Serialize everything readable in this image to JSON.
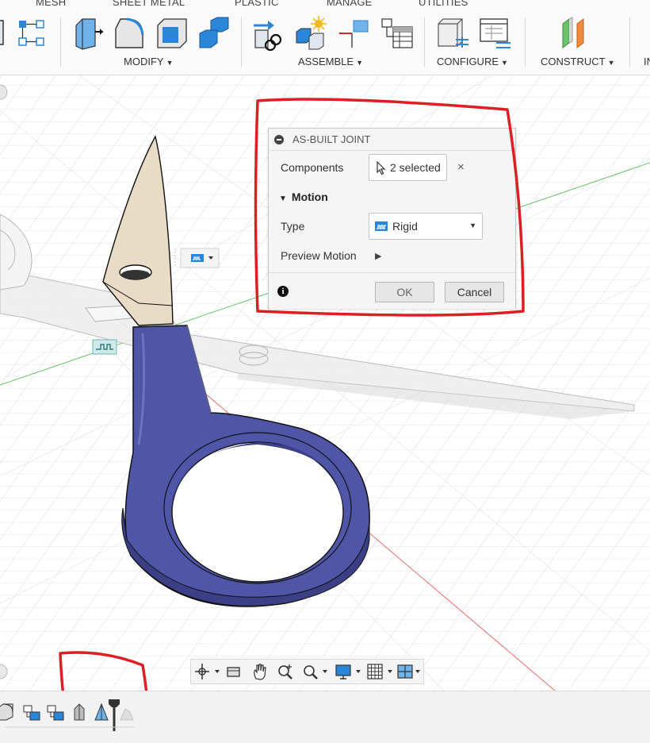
{
  "toolbar": {
    "tabs": [
      "MESH",
      "SHEET METAL",
      "PLASTIC",
      "MANAGE",
      "UTILITIES"
    ],
    "groups": {
      "modify": "MODIFY",
      "assemble": "ASSEMBLE",
      "configure": "CONFIGURE",
      "construct": "CONSTRUCT",
      "inspect_partial": "IN"
    }
  },
  "dialog": {
    "title": "AS-BUILT JOINT",
    "components_label": "Components",
    "components_value": "2 selected",
    "clear_symbol": "×",
    "motion_label": "Motion",
    "type_label": "Type",
    "type_value": "Rigid",
    "preview_label": "Preview Motion",
    "ok_label": "OK",
    "cancel_label": "Cancel"
  },
  "colors": {
    "annotation_red": "#dd1f24",
    "handle_blue": "#4f56a8",
    "blade_tan": "#e8dcc6",
    "accent_blue": "#1d7fd6"
  },
  "icons": {
    "joint_type": "rigid-joint-icon",
    "nav": [
      "orbit-icon",
      "look-at-icon",
      "pan-icon",
      "zoom-icon",
      "fit-icon",
      "display-icon",
      "grid-icon",
      "viewports-icon"
    ],
    "timeline": [
      "component-icon",
      "joint-icon",
      "joint-icon",
      "as-built-joint-icon",
      "sketch-icon",
      "marker-icon"
    ]
  }
}
